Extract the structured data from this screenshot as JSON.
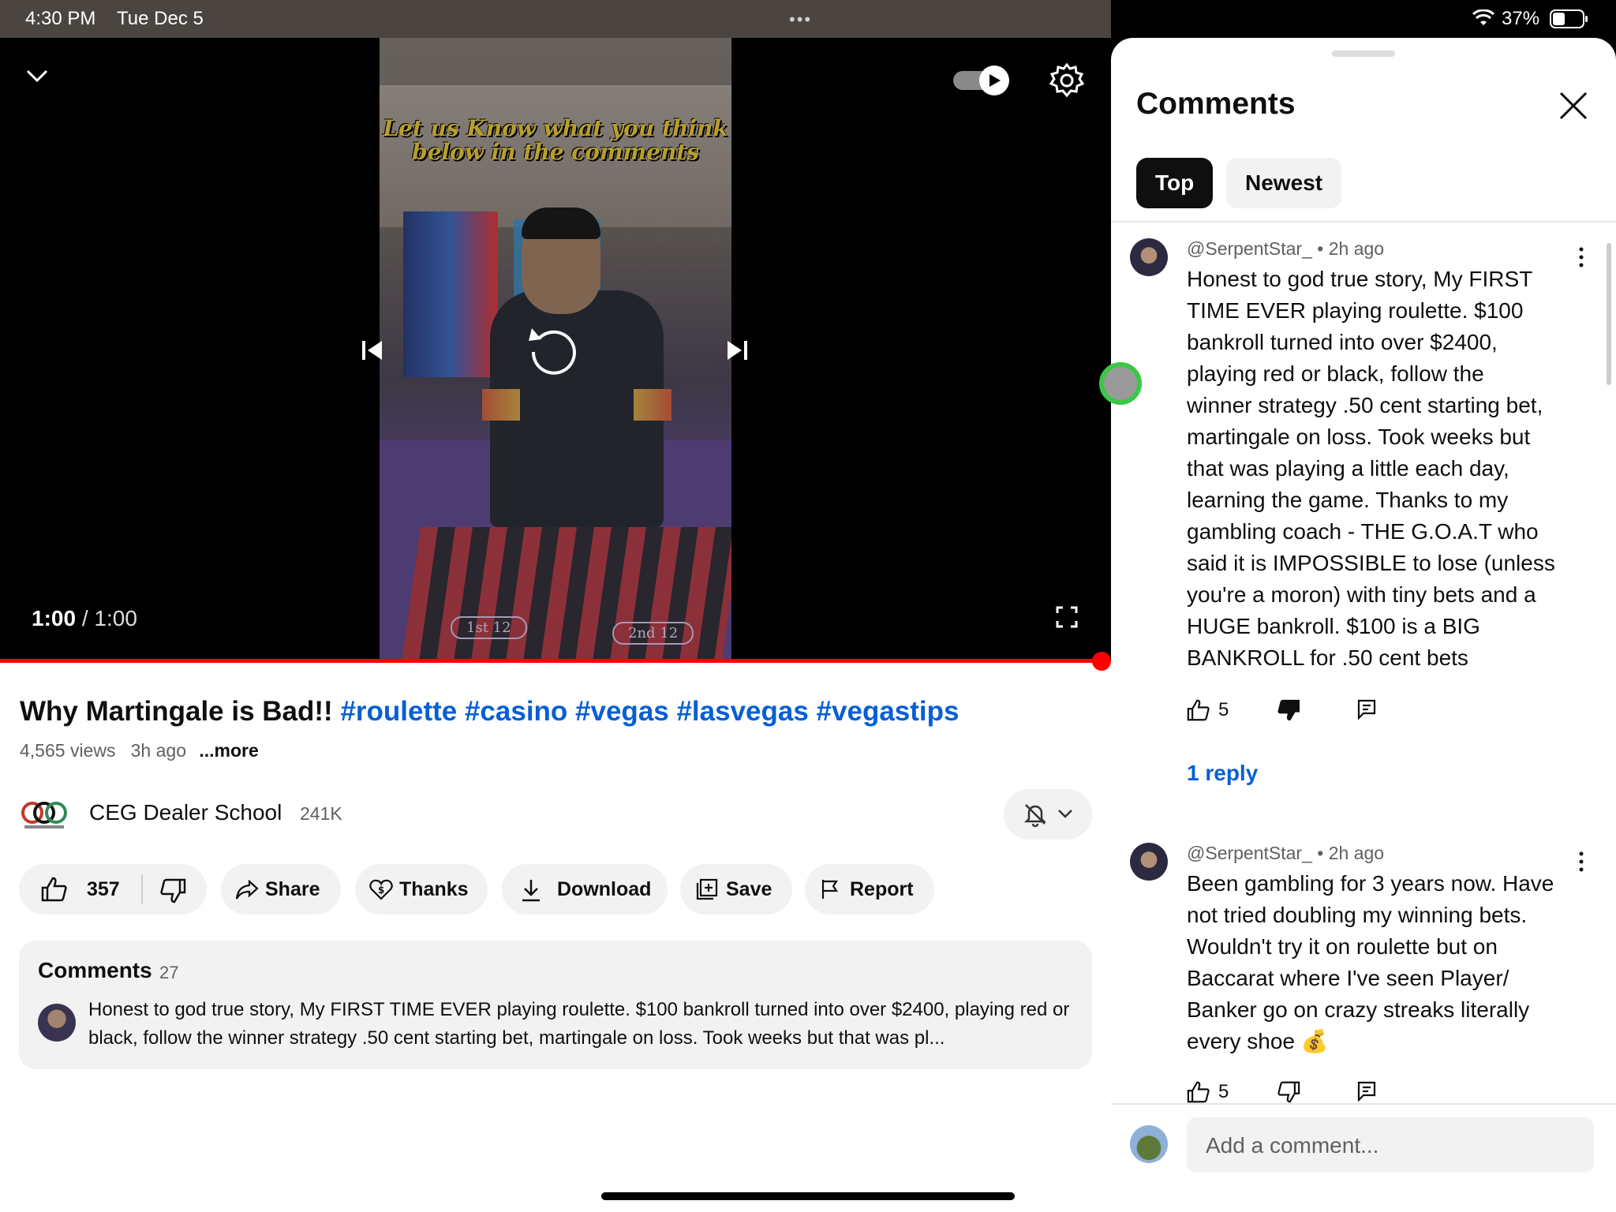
{
  "status_bar": {
    "time": "4:30 PM",
    "date": "Tue Dec 5",
    "dots": "•••",
    "battery": "37%"
  },
  "video": {
    "overlay_text": "Let us Know what you think below in the comments",
    "current_time": "1:00",
    "separator": " / ",
    "duration": "1:00",
    "bet_labels": [
      "1st 12",
      "2nd 12"
    ],
    "progress": 1.0,
    "autoplay_on": true
  },
  "title": {
    "text": "Why Martingale is Bad!! ",
    "hashtags": "#roulette #casino #vegas #lasvegas #vegastips"
  },
  "meta": {
    "views": "4,565 views",
    "age": "3h ago",
    "more": "...more"
  },
  "channel": {
    "name": "CEG Dealer School",
    "subs": "241K"
  },
  "actions": {
    "likes": "357",
    "share": "Share",
    "thanks": "Thanks",
    "download": "Download",
    "save": "Save",
    "report": "Report"
  },
  "comments_teaser": {
    "title": "Comments",
    "count": "27",
    "text": "Honest to god true story, My FIRST TIME EVER playing roulette. $100 bankroll turned into over $2400, playing red or black, follow the winner strategy .50 cent starting bet, martingale on loss. Took weeks but that was pl..."
  },
  "panel": {
    "title": "Comments",
    "tabs": [
      "Top",
      "Newest"
    ],
    "comments": [
      {
        "handle": "@SerpentStar_",
        "age": "2h ago",
        "lines": [
          "Honest to god true story, My FIRST",
          "TIME EVER playing roulette. $100",
          "bankroll turned into over $2400,",
          "playing red or black, follow the",
          "winner strategy .50 cent starting bet,",
          "martingale on loss. Took weeks but",
          "that was playing a little each day,",
          "learning the game. Thanks to my",
          "gambling coach - THE G.O.A.T who",
          "said it is IMPOSSIBLE to lose (unless",
          "you're a moron) with tiny bets and a",
          "HUGE bankroll. $100 is a BIG",
          "BANKROLL for .50 cent bets"
        ],
        "likes": "5",
        "replies": "1 reply"
      },
      {
        "handle": "@SerpentStar_",
        "age": "2h ago",
        "lines": [
          "Been gambling for 3 years now. Have",
          "not tried doubling my winning bets.",
          "Wouldn't try it on roulette but on",
          "Baccarat where I've seen Player/",
          "Banker go on crazy streaks literally",
          "every shoe 💰"
        ],
        "likes": "5"
      }
    ],
    "add_placeholder": "Add a comment..."
  },
  "colors": {
    "accent_red": "#ff0000",
    "link_blue": "#065fd4",
    "touch_ring": "#3ac846"
  }
}
